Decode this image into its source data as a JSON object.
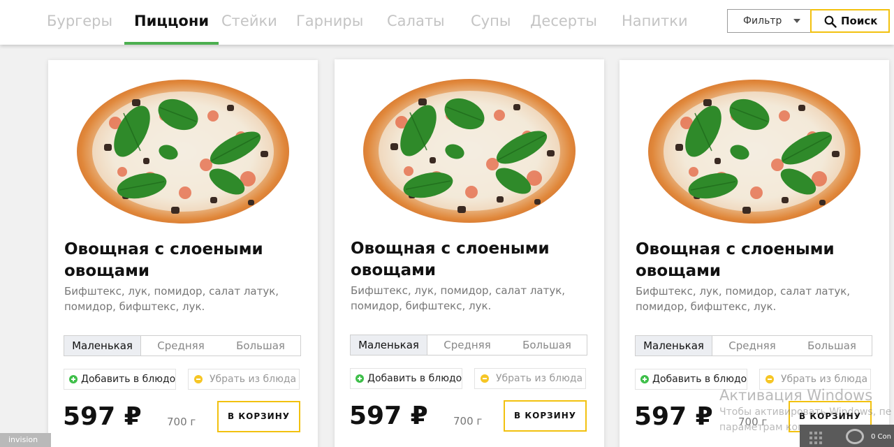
{
  "nav": {
    "tabs": [
      {
        "label": "Бургеры"
      },
      {
        "label": "Пиццони"
      },
      {
        "label": "Стейки"
      },
      {
        "label": "Гарниры"
      },
      {
        "label": "Салаты"
      },
      {
        "label": "Супы"
      },
      {
        "label": "Десерты"
      },
      {
        "label": "Напитки"
      }
    ],
    "active_tab": "Пиццони",
    "filter_label": "Фильтр",
    "search_label": "Поиск"
  },
  "products": [
    {
      "title": "Овощная с слоеными овощами",
      "description": "Бифштекс, лук, помидор, салат латук, помидор, бифштекс, лук.",
      "sizes": [
        "Маленькая",
        "Средняя",
        "Большая"
      ],
      "selected_size": "Маленькая",
      "add_label": "Добавить в блюдо",
      "remove_label": "Убрать из блюда",
      "price": "597 ₽",
      "weight": "700 г",
      "cart_label": "В КОРЗИНУ"
    },
    {
      "title": "Овощная с слоеными овощами",
      "description": "Бифштекс, лук, помидор, салат латук, помидор, бифштекс, лук.",
      "sizes": [
        "Маленькая",
        "Средняя",
        "Большая"
      ],
      "selected_size": "Маленькая",
      "add_label": "Добавить в блюдо",
      "remove_label": "Убрать из блюда",
      "price": "597 ₽",
      "weight": "700 г",
      "cart_label": "В КОРЗИНУ"
    },
    {
      "title": "Овощная с слоеными овощами",
      "description": "Бифштекс, лук, помидор, салат латук, помидор, бифштекс, лук.",
      "sizes": [
        "Маленькая",
        "Средняя",
        "Большая"
      ],
      "selected_size": "Маленькая",
      "add_label": "Добавить в блюдо",
      "remove_label": "Убрать из блюда",
      "price": "597 ₽",
      "weight": "700 г",
      "cart_label": "В КОРЗИНУ"
    }
  ],
  "overlay": {
    "invision_label": "invision",
    "windows_title": "Активация Windows",
    "windows_line1": "Чтобы активировать Windows, пе",
    "windows_line2": "параметрам компьютера.",
    "tray_text": "0 Con"
  },
  "colors": {
    "accent_active": "#4caf50",
    "button_border": "#f2c10f",
    "add_dot": "#3fbf4a",
    "remove_dot": "#f6c625"
  }
}
